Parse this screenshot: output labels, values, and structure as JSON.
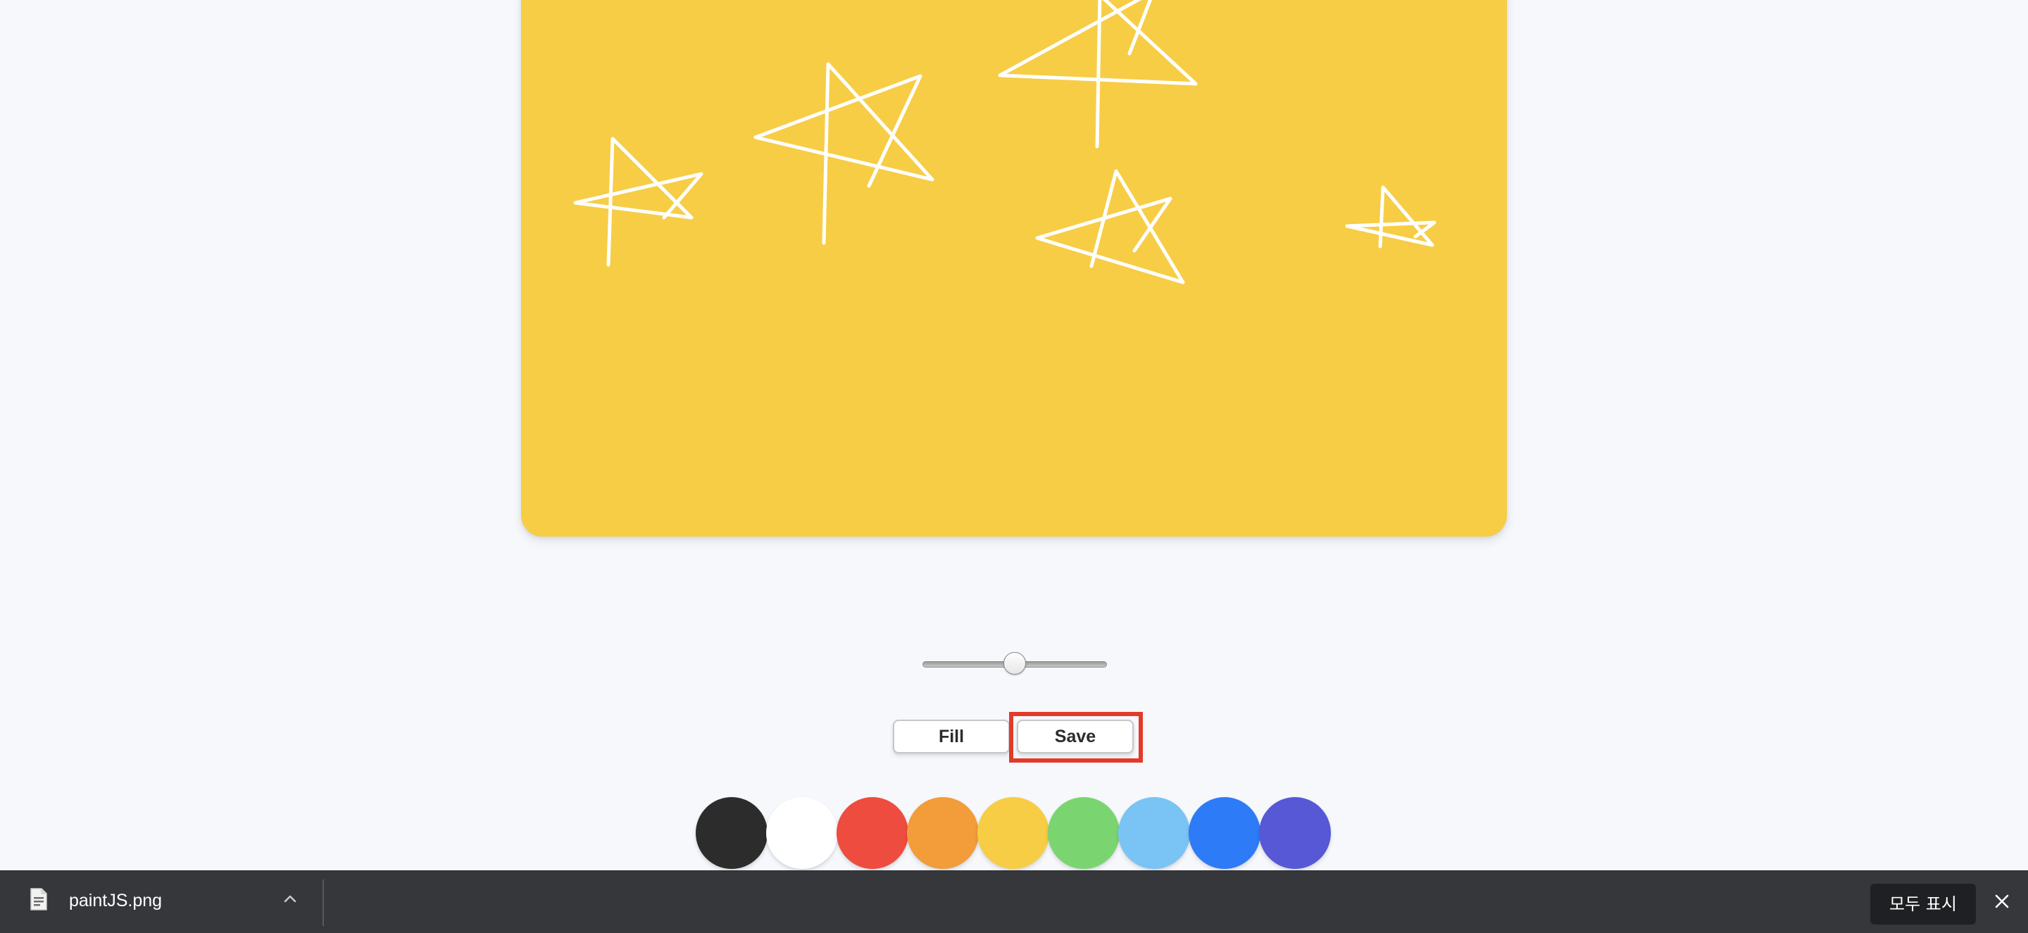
{
  "canvas": {
    "background_color": "#f7cd45",
    "stroke_color": "#ffffff",
    "drawing": "white hand-drawn stars"
  },
  "brush_size": {
    "value_fraction": 0.5
  },
  "controls": {
    "fill_label": "Fill",
    "save_label": "Save"
  },
  "highlight": {
    "color": "#e33a2a",
    "target": "save-button"
  },
  "palette": {
    "colors": [
      "#2c2c2c",
      "#ffffff",
      "#ee4c3e",
      "#f29c3a",
      "#f7cd45",
      "#7ad570",
      "#7ac4f5",
      "#2d7bf6",
      "#5658d6"
    ]
  },
  "download_bar": {
    "file_icon": "document-icon",
    "file_name": "paintJS.png",
    "show_all_label": "모두 표시",
    "close_icon": "close-icon"
  }
}
